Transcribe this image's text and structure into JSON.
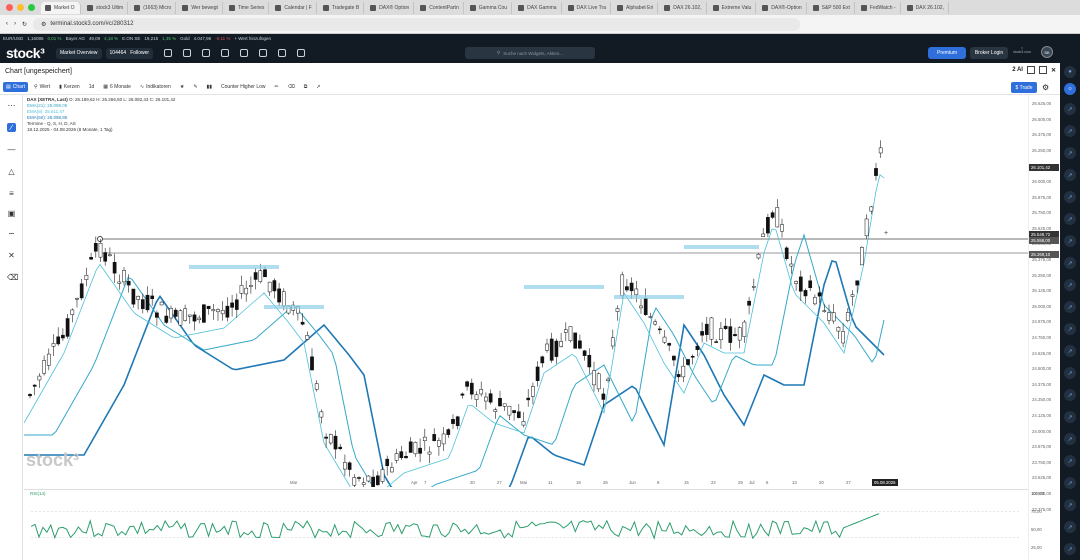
{
  "tabs": [
    {
      "title": "Market O",
      "active": true
    },
    {
      "title": "stock3 Ultim"
    },
    {
      "title": "(1663) Micro"
    },
    {
      "title": "Wer bewegt"
    },
    {
      "title": "Time Series"
    },
    {
      "title": "Calendar | F"
    },
    {
      "title": "Tradegate B"
    },
    {
      "title": "DAX® Option"
    },
    {
      "title": "ContentPartn"
    },
    {
      "title": "Gamma Cou"
    },
    {
      "title": "DAX Gamma"
    },
    {
      "title": "DAX Live Tra"
    },
    {
      "title": "Alphabet Eri"
    },
    {
      "title": "DAX 26.102,"
    },
    {
      "title": "Extreme Valu"
    },
    {
      "title": "DAX®-Option"
    },
    {
      "title": "S&P 500 Ext"
    },
    {
      "title": "FedWatch -"
    },
    {
      "title": "DAX 26.102,"
    }
  ],
  "address": {
    "url": "terminal.stock3.com/#c/280312"
  },
  "ticker": [
    {
      "name": "EUR/USD",
      "value": "1,16086",
      "change": "0,01 %",
      "dir": "up"
    },
    {
      "name": "Bayer AG",
      "value": "49,09",
      "change": "4,18 %",
      "dir": "up"
    },
    {
      "name": "E.ON SE",
      "value": "19,215",
      "change": "1,35 %",
      "dir": "up"
    },
    {
      "name": "Gold",
      "value": "4.047,96",
      "change": "-0,11 %",
      "dir": "dn"
    },
    {
      "name": "+ Wert hinzufügen",
      "value": "",
      "change": "",
      "dir": ""
    }
  ],
  "header": {
    "logo": "stock³",
    "market_overview": "Market Overview",
    "followers_count": "104464",
    "followers_label": "Follower",
    "search_placeholder": "Suche nach Widgets, Aktien...",
    "premium": "Premium",
    "broker_login": "Broker Login",
    "avatar": "SK",
    "stock3_label": "stock3.com"
  },
  "chart_title": "Chart [ungespeichert]",
  "chart_toolbar": {
    "chart": "Chart",
    "wert": "Wert",
    "kerzen": "Kerzen",
    "interval": "1d",
    "range": "6 Monate",
    "indikatoren": "Indikatoren",
    "drawing": "Counter Higher Low",
    "trade": "$ Trade",
    "layout": "2 AI"
  },
  "legend": {
    "instrument": "DAX (XETRA, Last)",
    "ohlc": "O: 26.189,62  H: 26.266,50  L: 26.082,43  C: 26.101,42",
    "ema1": "EMA(21): 25.098,05",
    "ema2": "EMA(9): 25.611,47",
    "ema3": "EMA(50): 25.098,95",
    "termine": "Termine - Q, S, H, D, AS",
    "period": "18.12.2025 - 04.08.2026  (8 Monate, 1 Tag)"
  },
  "y_axis": [
    "26.625,00",
    "26.500,00",
    "26.375,00",
    "26.250,00",
    "26.125,00",
    "26.000,00",
    "25.875,00",
    "25.750,00",
    "25.625,00",
    "25.500,00",
    "25.375,00",
    "25.250,00",
    "25.125,00",
    "25.000,00",
    "24.875,00",
    "24.750,00",
    "24.625,00",
    "24.500,00",
    "24.375,00",
    "24.250,00",
    "24.125,00",
    "24.000,00",
    "23.875,00",
    "23.750,00",
    "23.625,00",
    "23.500,00",
    "23.375,00"
  ],
  "price_tags": {
    "last": "26.101,42",
    "line1": "25.548,72",
    "line2": "25.558,00",
    "line3": "25.269,10"
  },
  "x_axis": [
    "Mar",
    "Apr",
    "7",
    "20",
    "27",
    "Mai",
    "11",
    "18",
    "25",
    "Jun",
    "8",
    "15",
    "22",
    "29",
    "Jul",
    "6",
    "13",
    "20",
    "27"
  ],
  "crosshair_date": "05.08.2026",
  "rsi": {
    "label": "RSI(14)",
    "levels": [
      "100,00",
      "75,00",
      "50,00",
      "25,00"
    ]
  },
  "watermark": "stock³",
  "colors": {
    "up": "#4cc36a",
    "down": "#e05555",
    "accent": "#2f6fdb",
    "ema_fast": "#4ec0d8",
    "ema_mid": "#35a8c8",
    "ema_slow": "#1e78b5",
    "rsi": "#2a9d6a"
  }
}
